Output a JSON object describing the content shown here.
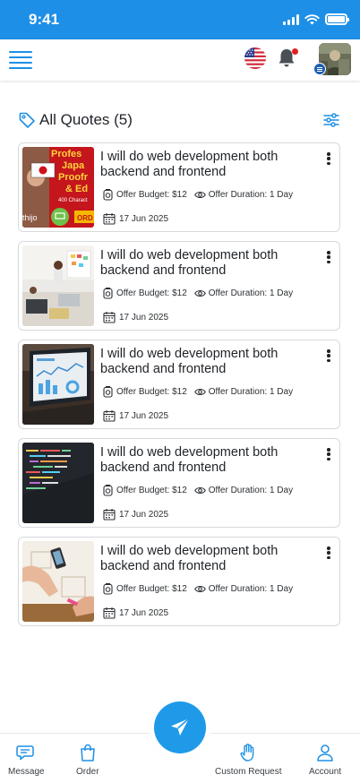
{
  "status_bar": {
    "time": "9:41"
  },
  "header": {
    "menu_icon": "hamburger-menu-icon",
    "language_icon": "us-flag-icon",
    "notification_icon": "bell-icon",
    "avatar_icon": "user-avatar"
  },
  "section": {
    "title": "All Quotes (5)",
    "icon": "tag-icon",
    "filter_icon": "filter-sliders-icon"
  },
  "quotes": [
    {
      "title": "I will do web development both backend and frontend",
      "budget": "Offer Budget: $12",
      "duration": "Offer Duration: 1 Day",
      "date": "17 Jun 2025",
      "thumb_text": {
        "line1": "Profes",
        "line2": "Japa",
        "line3": "Proofr",
        "line4": "& Ed",
        "line5": "400 Charact",
        "line6": "thijo",
        "line7": "ORD"
      }
    },
    {
      "title": "I will do web development both backend and frontend",
      "budget": "Offer Budget: $12",
      "duration": "Offer Duration: 1 Day",
      "date": "17 Jun 2025"
    },
    {
      "title": "I will do web development both backend and frontend",
      "budget": "Offer Budget: $12",
      "duration": "Offer Duration: 1 Day",
      "date": "17 Jun 2025"
    },
    {
      "title": "I will do web development both backend and frontend",
      "budget": "Offer Budget: $12",
      "duration": "Offer Duration: 1 Day",
      "date": "17 Jun 2025"
    },
    {
      "title": "I will do web development both backend and frontend",
      "budget": "Offer Budget: $12",
      "duration": "Offer Duration: 1 Day",
      "date": "17 Jun 2025"
    }
  ],
  "bottom_nav": {
    "message": "Message",
    "order": "Order",
    "fab_icon": "send-paper-plane-icon",
    "custom_request": "Custom Request",
    "account": "Account"
  },
  "colors": {
    "primary": "#1e8fe6",
    "fab": "#1e9ae9",
    "notification_dot": "#e02020"
  }
}
